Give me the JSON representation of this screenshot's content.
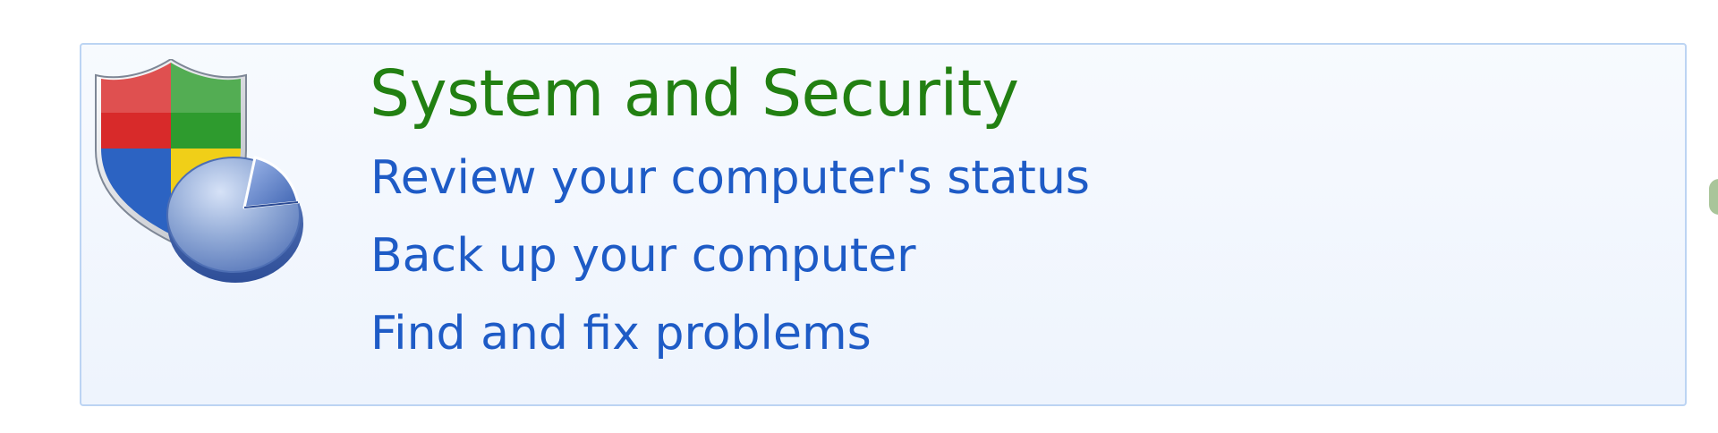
{
  "category": {
    "title": "System and Security",
    "icon": "shield-with-pie-chart-icon",
    "title_color": "#228012",
    "link_color": "#1e5bc6",
    "tasks": [
      {
        "label": "Review your computer's status"
      },
      {
        "label": "Back up your computer"
      },
      {
        "label": "Find and fix problems"
      }
    ]
  }
}
